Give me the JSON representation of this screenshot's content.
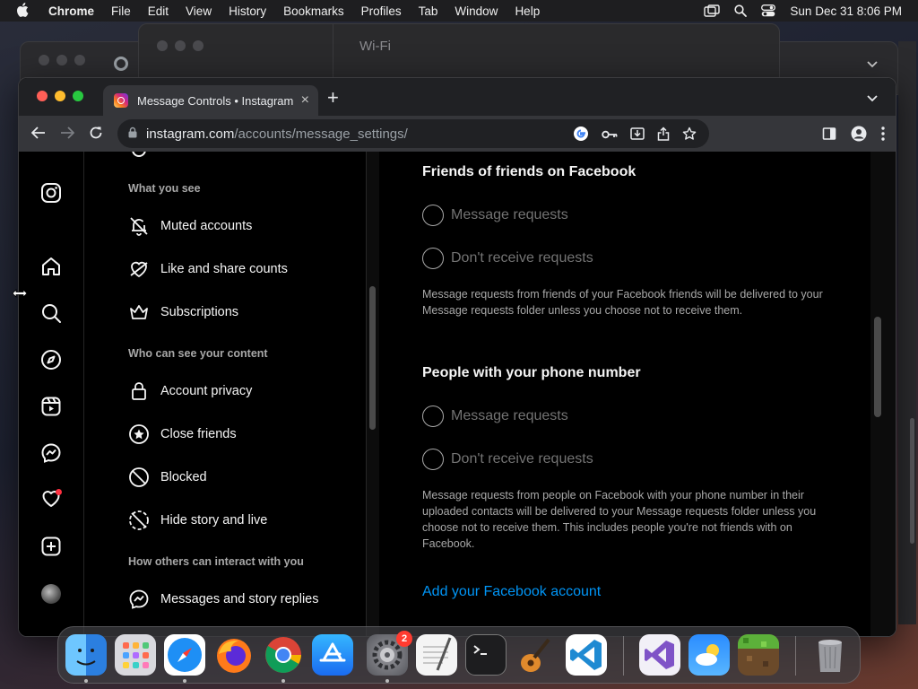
{
  "menubar": {
    "app": "Chrome",
    "items": [
      "File",
      "Edit",
      "View",
      "History",
      "Bookmarks",
      "Profiles",
      "Tab",
      "Window",
      "Help"
    ],
    "datetime": "Sun Dec 31  8:06 PM"
  },
  "bg_window": {
    "title": "Wi-Fi"
  },
  "browser": {
    "tab_title": "Message Controls • Instagram",
    "tab_close": "×",
    "new_tab": "+",
    "url_host": "instagram.com",
    "url_path": "/accounts/message_settings/"
  },
  "settings": {
    "sections": [
      {
        "heading": "What you see",
        "items": [
          {
            "label": "Muted accounts",
            "icon": "muted-bell-icon"
          },
          {
            "label": "Like and share counts",
            "icon": "heart-off-icon"
          },
          {
            "label": "Subscriptions",
            "icon": "crown-icon"
          }
        ]
      },
      {
        "heading": "Who can see your content",
        "items": [
          {
            "label": "Account privacy",
            "icon": "lock-icon"
          },
          {
            "label": "Close friends",
            "icon": "star-circle-icon"
          },
          {
            "label": "Blocked",
            "icon": "blocked-icon"
          },
          {
            "label": "Hide story and live",
            "icon": "hide-story-icon"
          }
        ]
      },
      {
        "heading": "How others can interact with you",
        "items": [
          {
            "label": "Messages and story replies",
            "icon": "messenger-icon"
          }
        ]
      }
    ]
  },
  "main": {
    "groups": [
      {
        "title": "Friends of friends on Facebook",
        "options": [
          "Message requests",
          "Don't receive requests"
        ],
        "description": "Message requests from friends of your Facebook friends will be delivered to your Message requests folder unless you choose not to receive them."
      },
      {
        "title": "People with your phone number",
        "options": [
          "Message requests",
          "Don't receive requests"
        ],
        "description": "Message requests from people on Facebook with your phone number in their uploaded contacts will be delivered to your Message requests folder unless you choose not to receive them. This includes people you're not friends with on Facebook."
      }
    ],
    "link": "Add your Facebook account"
  },
  "dock": {
    "settings_badge": "2",
    "apps": [
      "Finder",
      "Launchpad",
      "Safari",
      "Firefox",
      "Chrome",
      "App Store",
      "System Settings",
      "TextEdit",
      "Terminal",
      "GarageBand",
      "Visual Studio Code",
      "Visual Studio",
      "Weather",
      "Minecraft",
      "Trash"
    ]
  },
  "colors": {
    "accent_link": "#0095f6",
    "notification_dot": "#ff3040",
    "badge": "#ff3b30"
  }
}
